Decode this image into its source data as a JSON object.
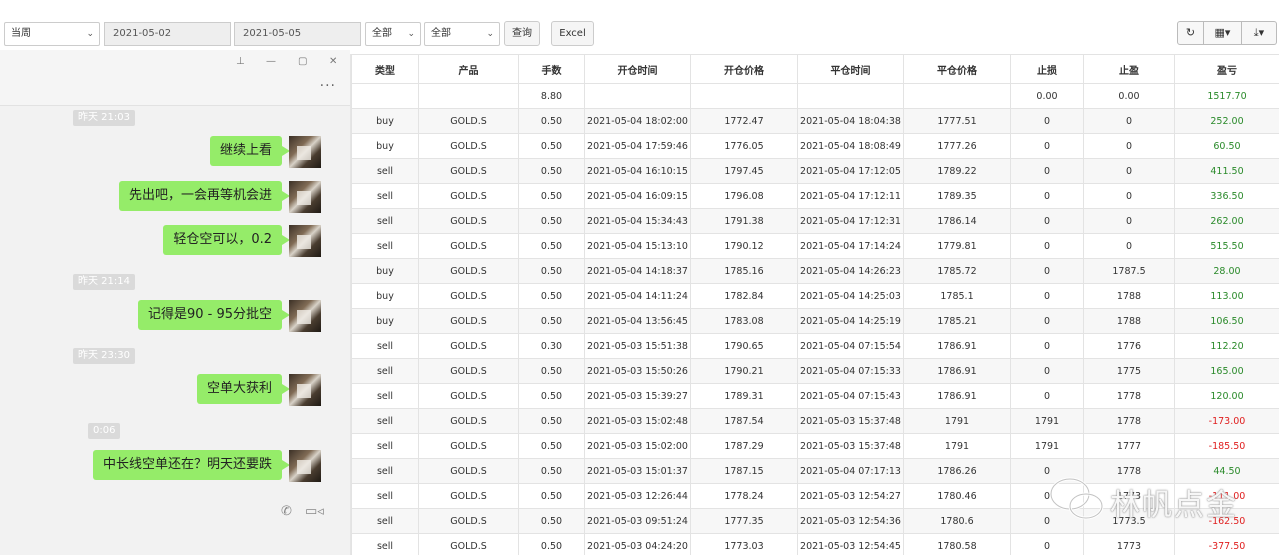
{
  "toolbar": {
    "period": "当周",
    "date_from": "2021-05-02",
    "date_to": "2021-05-05",
    "filter1": "全部",
    "filter2": "全部",
    "query_label": "查询",
    "excel_label": "Excel"
  },
  "chat": {
    "messages": [
      {
        "type": "time",
        "text": "昨天 21:03"
      },
      {
        "type": "msg",
        "text": "继续上看"
      },
      {
        "type": "msg",
        "text": "先出吧，一会再等机会进"
      },
      {
        "type": "msg",
        "text": "轻仓空可以，0.2"
      },
      {
        "type": "time",
        "text": "昨天 21:14"
      },
      {
        "type": "msg",
        "text": "记得是90 - 95分批空"
      },
      {
        "type": "time",
        "text": "昨天 23:30"
      },
      {
        "type": "msg",
        "text": "空单大获利"
      },
      {
        "type": "time",
        "text": "0:06"
      },
      {
        "type": "msg",
        "text": "中长线空单还在？明天还要跌"
      }
    ]
  },
  "table": {
    "headers": [
      "类型",
      "产品",
      "手数",
      "开仓时间",
      "开仓价格",
      "平仓时间",
      "平仓价格",
      "止损",
      "止盈",
      "盈亏"
    ],
    "summary": [
      "",
      "",
      "8.80",
      "",
      "",
      "",
      "",
      "0.00",
      "0.00",
      "1517.70"
    ],
    "rows": [
      [
        "buy",
        "GOLD.S",
        "0.50",
        "2021-05-04 18:02:00",
        "1772.47",
        "2021-05-04 18:04:38",
        "1777.51",
        "0",
        "0",
        "252.00"
      ],
      [
        "buy",
        "GOLD.S",
        "0.50",
        "2021-05-04 17:59:46",
        "1776.05",
        "2021-05-04 18:08:49",
        "1777.26",
        "0",
        "0",
        "60.50"
      ],
      [
        "sell",
        "GOLD.S",
        "0.50",
        "2021-05-04 16:10:15",
        "1797.45",
        "2021-05-04 17:12:05",
        "1789.22",
        "0",
        "0",
        "411.50"
      ],
      [
        "sell",
        "GOLD.S",
        "0.50",
        "2021-05-04 16:09:15",
        "1796.08",
        "2021-05-04 17:12:11",
        "1789.35",
        "0",
        "0",
        "336.50"
      ],
      [
        "sell",
        "GOLD.S",
        "0.50",
        "2021-05-04 15:34:43",
        "1791.38",
        "2021-05-04 17:12:31",
        "1786.14",
        "0",
        "0",
        "262.00"
      ],
      [
        "sell",
        "GOLD.S",
        "0.50",
        "2021-05-04 15:13:10",
        "1790.12",
        "2021-05-04 17:14:24",
        "1779.81",
        "0",
        "0",
        "515.50"
      ],
      [
        "buy",
        "GOLD.S",
        "0.50",
        "2021-05-04 14:18:37",
        "1785.16",
        "2021-05-04 14:26:23",
        "1785.72",
        "0",
        "1787.5",
        "28.00"
      ],
      [
        "buy",
        "GOLD.S",
        "0.50",
        "2021-05-04 14:11:24",
        "1782.84",
        "2021-05-04 14:25:03",
        "1785.1",
        "0",
        "1788",
        "113.00"
      ],
      [
        "buy",
        "GOLD.S",
        "0.50",
        "2021-05-04 13:56:45",
        "1783.08",
        "2021-05-04 14:25:19",
        "1785.21",
        "0",
        "1788",
        "106.50"
      ],
      [
        "sell",
        "GOLD.S",
        "0.30",
        "2021-05-03 15:51:38",
        "1790.65",
        "2021-05-04 07:15:54",
        "1786.91",
        "0",
        "1776",
        "112.20"
      ],
      [
        "sell",
        "GOLD.S",
        "0.50",
        "2021-05-03 15:50:26",
        "1790.21",
        "2021-05-04 07:15:33",
        "1786.91",
        "0",
        "1775",
        "165.00"
      ],
      [
        "sell",
        "GOLD.S",
        "0.50",
        "2021-05-03 15:39:27",
        "1789.31",
        "2021-05-04 07:15:43",
        "1786.91",
        "0",
        "1778",
        "120.00"
      ],
      [
        "sell",
        "GOLD.S",
        "0.50",
        "2021-05-03 15:02:48",
        "1787.54",
        "2021-05-03 15:37:48",
        "1791",
        "1791",
        "1778",
        "-173.00"
      ],
      [
        "sell",
        "GOLD.S",
        "0.50",
        "2021-05-03 15:02:00",
        "1787.29",
        "2021-05-03 15:37:48",
        "1791",
        "1791",
        "1777",
        "-185.50"
      ],
      [
        "sell",
        "GOLD.S",
        "0.50",
        "2021-05-03 15:01:37",
        "1787.15",
        "2021-05-04 07:17:13",
        "1786.26",
        "0",
        "1778",
        "44.50"
      ],
      [
        "sell",
        "GOLD.S",
        "0.50",
        "2021-05-03 12:26:44",
        "1778.24",
        "2021-05-03 12:54:27",
        "1780.46",
        "0",
        "1773",
        "-111.00"
      ],
      [
        "sell",
        "GOLD.S",
        "0.50",
        "2021-05-03 09:51:24",
        "1777.35",
        "2021-05-03 12:54:36",
        "1780.6",
        "0",
        "1773.5",
        "-162.50"
      ],
      [
        "sell",
        "GOLD.S",
        "0.50",
        "2021-05-03 04:24:20",
        "1773.03",
        "2021-05-03 12:54:45",
        "1780.58",
        "0",
        "1773",
        "-377.50"
      ]
    ]
  },
  "watermark": "林帆点金",
  "colors": {
    "profit": "#2a8a2a",
    "loss": "#e02020",
    "bubble": "#95ec69"
  }
}
